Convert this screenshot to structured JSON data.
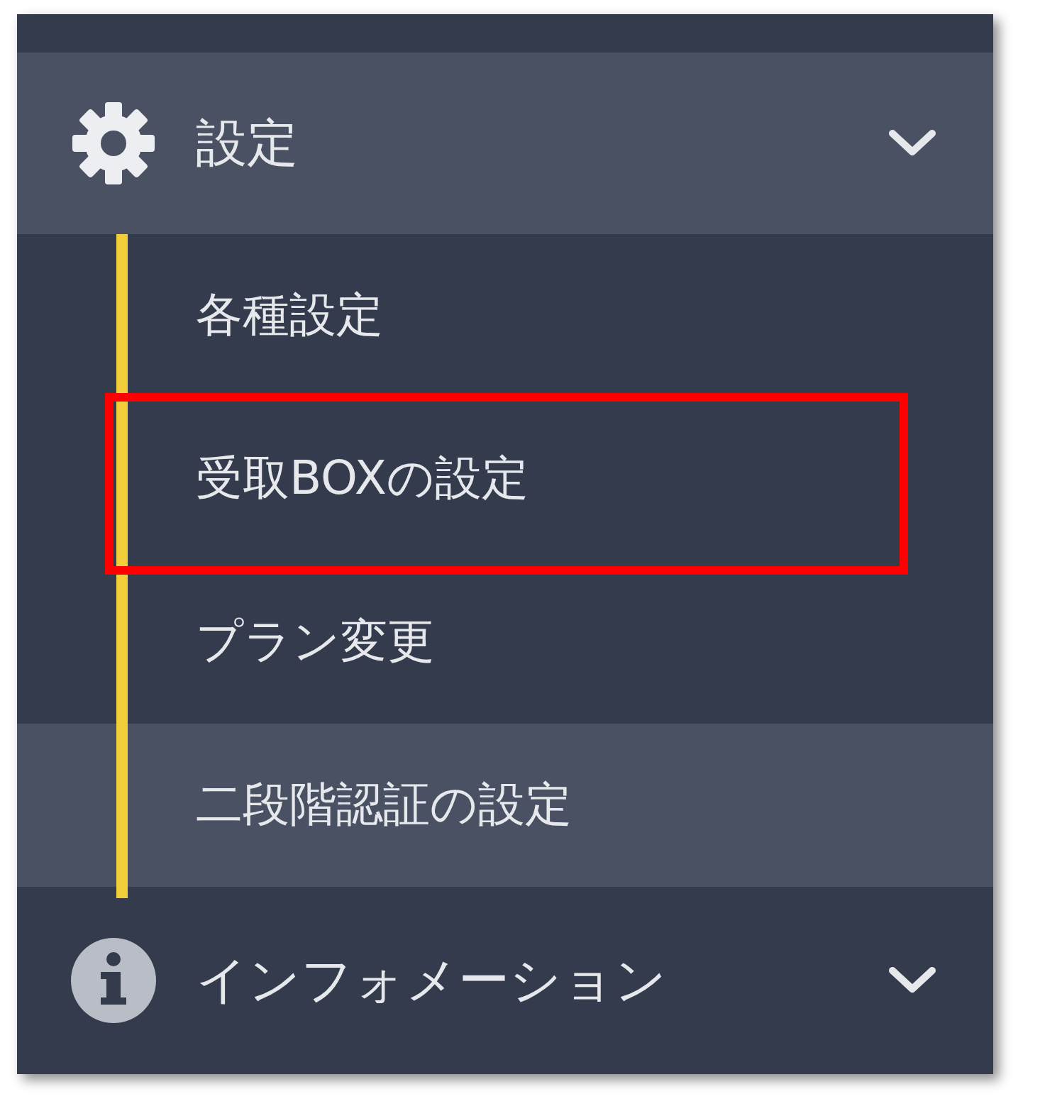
{
  "menu": [
    {
      "label": "設定",
      "kind": "gear",
      "children": [
        {
          "label": "各種設定",
          "selected": false,
          "highlighted": false
        },
        {
          "label": "受取BOXの設定",
          "selected": false,
          "highlighted": true
        },
        {
          "label": "プラン変更",
          "selected": false,
          "highlighted": false
        },
        {
          "label": "二段階認証の設定",
          "selected": true,
          "highlighted": false
        }
      ]
    },
    {
      "label": "インフォメーション",
      "kind": "info"
    }
  ]
}
